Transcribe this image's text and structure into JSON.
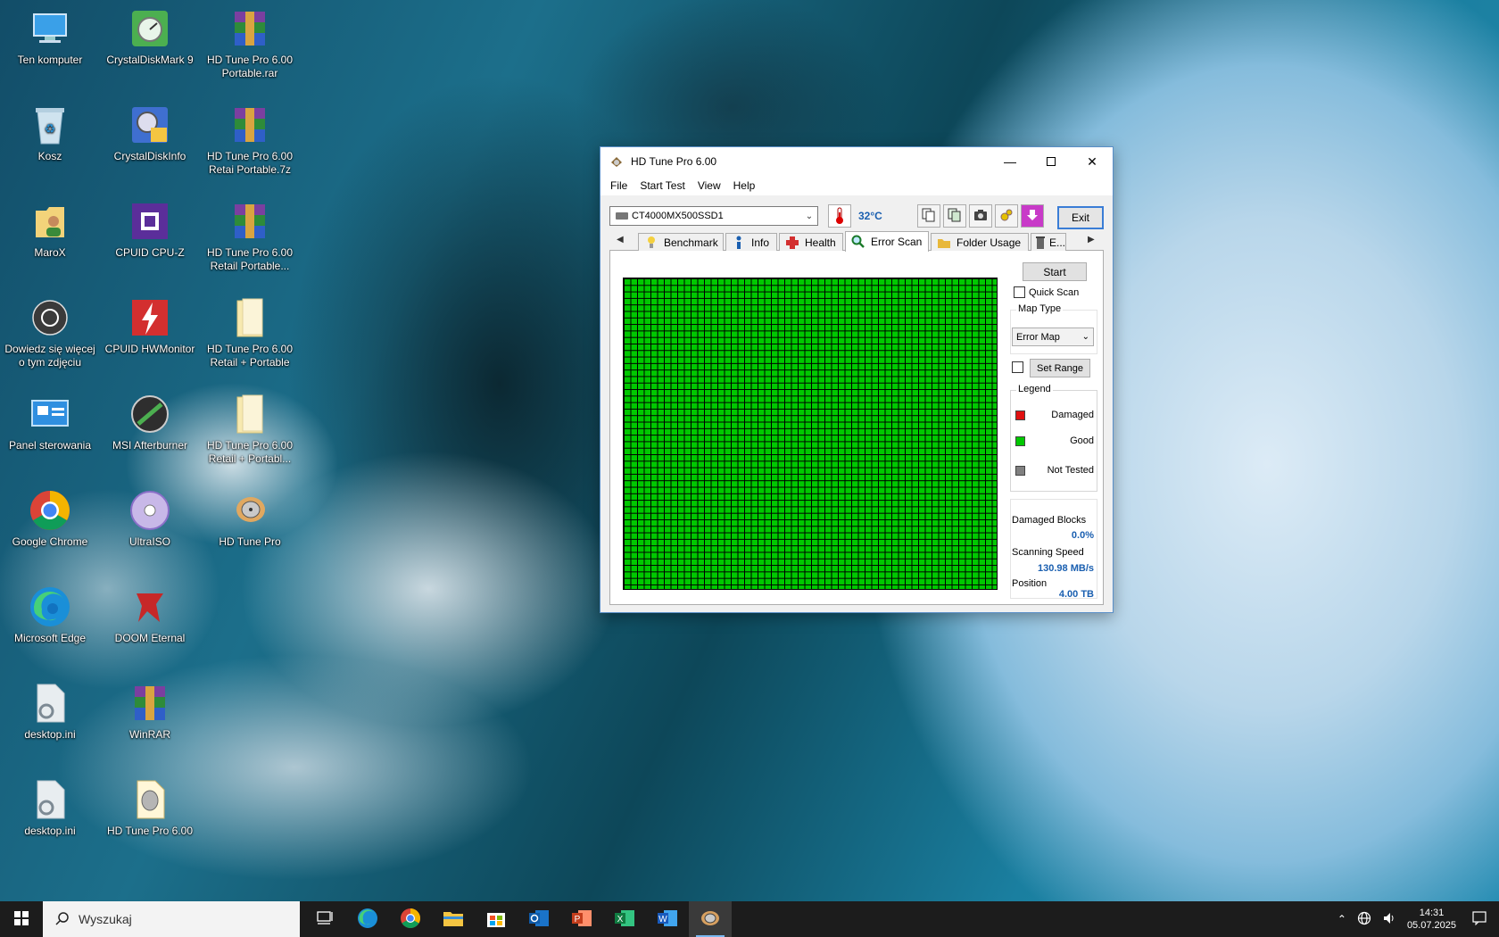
{
  "desktop": {
    "icons": [
      {
        "label": "Ten komputer",
        "icon": "computer-icon"
      },
      {
        "label": "CrystalDiskMark 9",
        "icon": "crystaldiskmark-icon"
      },
      {
        "label": "HD Tune Pro 6.00 Portable.rar",
        "icon": "winrar-archive-icon"
      },
      {
        "label": "Kosz",
        "icon": "recycle-bin-icon"
      },
      {
        "label": "CrystalDiskInfo",
        "icon": "crystaldiskinfo-icon"
      },
      {
        "label": "HD Tune Pro 6.00 Retai Portable.7z",
        "icon": "winrar-archive-icon"
      },
      {
        "label": "MaroX",
        "icon": "user-folder-icon"
      },
      {
        "label": "CPUID CPU-Z",
        "icon": "cpuz-icon"
      },
      {
        "label": "HD Tune Pro 6.00 Retail Portable...",
        "icon": "winrar-archive-icon"
      },
      {
        "label": "Dowiedz się więcej o tym zdjęciu",
        "icon": "camera-info-icon"
      },
      {
        "label": "CPUID HWMonitor",
        "icon": "hwmonitor-icon"
      },
      {
        "label": "HD Tune Pro 6.00 Retail + Portable",
        "icon": "folder-icon"
      },
      {
        "label": "Panel sterowania",
        "icon": "control-panel-icon"
      },
      {
        "label": "MSI Afterburner",
        "icon": "msi-afterburner-icon"
      },
      {
        "label": "HD Tune Pro 6.00 Retail + Portabl...",
        "icon": "folder-icon"
      },
      {
        "label": "Google Chrome",
        "icon": "chrome-icon"
      },
      {
        "label": "UltraISO",
        "icon": "ultraiso-icon"
      },
      {
        "label": "HD Tune Pro",
        "icon": "hdtune-icon"
      },
      {
        "label": "Microsoft Edge",
        "icon": "edge-icon"
      },
      {
        "label": "DOOM Eternal",
        "icon": "doom-icon"
      },
      {
        "label": "desktop.ini",
        "icon": "settings-file-icon"
      },
      {
        "label": "WinRAR",
        "icon": "winrar-icon"
      },
      {
        "label": "desktop.ini",
        "icon": "settings-file-icon"
      },
      {
        "label": "HD Tune Pro 6.00",
        "icon": "hdtune-file-icon"
      }
    ]
  },
  "window": {
    "title": "HD Tune Pro 6.00",
    "menu": [
      "File",
      "Start Test",
      "View",
      "Help"
    ],
    "drive": "CT4000MX500SSD1",
    "temperature": "32°C",
    "exit_label": "Exit",
    "tabs": [
      {
        "label": "Benchmark",
        "icon": "benchmark-icon"
      },
      {
        "label": "Info",
        "icon": "info-icon"
      },
      {
        "label": "Health",
        "icon": "health-icon"
      },
      {
        "label": "Error Scan",
        "icon": "magnifier-icon"
      },
      {
        "label": "Folder Usage",
        "icon": "folder-icon"
      },
      {
        "label": "E...",
        "icon": "erase-icon"
      }
    ],
    "active_tab": "Error Scan",
    "error_scan": {
      "start_label": "Start",
      "quick_scan_label": "Quick Scan",
      "quick_scan_checked": false,
      "map_type_label": "Map Type",
      "map_type_value": "Error Map",
      "set_range_label": "Set Range",
      "set_range_checked": false,
      "legend_label": "Legend",
      "legend": [
        {
          "label": "Damaged",
          "color": "#e01010"
        },
        {
          "label": "Good",
          "color": "#00c800"
        },
        {
          "label": "Not Tested",
          "color": "#808080"
        }
      ],
      "damaged_blocks_label": "Damaged Blocks",
      "damaged_blocks_value": "0.0%",
      "scanning_speed_label": "Scanning Speed",
      "scanning_speed_value": "130.98 MB/s",
      "position_label": "Position",
      "position_value": "4.00 TB",
      "map_status": "Good",
      "map_color": "#00c800"
    }
  },
  "taskbar": {
    "search_placeholder": "Wyszukaj",
    "apps": [
      "task-view-icon",
      "edge-icon",
      "chrome-icon",
      "file-explorer-icon",
      "store-icon",
      "outlook-icon",
      "powerpoint-icon",
      "excel-icon",
      "word-icon",
      "hdtune-icon"
    ],
    "time": "14:31",
    "date": "05.07.2025"
  },
  "colors": {
    "accent": "#3a7dd6",
    "value_blue": "#1a5fb0"
  }
}
